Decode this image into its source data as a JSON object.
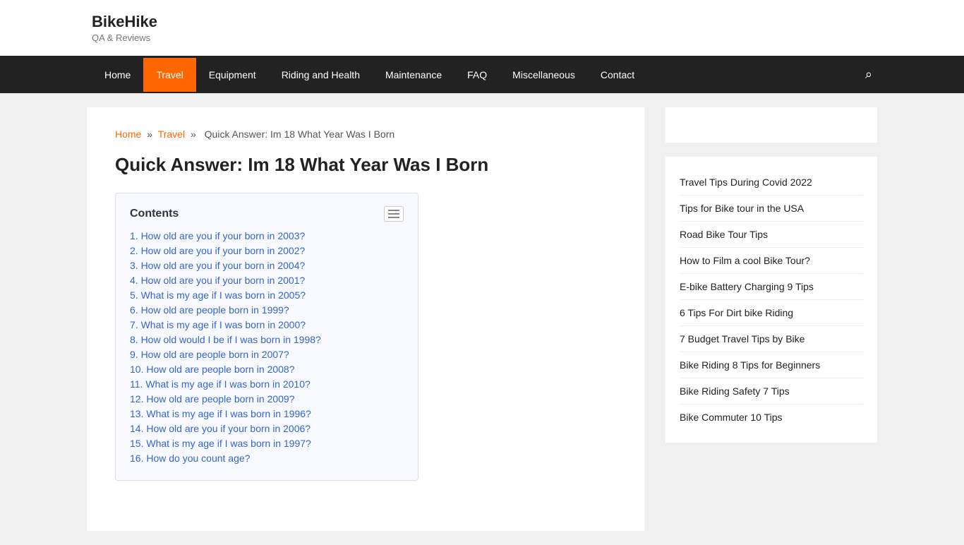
{
  "site": {
    "title": "BikeHike",
    "subtitle": "QA & Reviews"
  },
  "nav": {
    "items": [
      {
        "label": "Home",
        "active": false
      },
      {
        "label": "Travel",
        "active": true
      },
      {
        "label": "Equipment",
        "active": false
      },
      {
        "label": "Riding and Health",
        "active": false
      },
      {
        "label": "Maintenance",
        "active": false
      },
      {
        "label": "FAQ",
        "active": false
      },
      {
        "label": "Miscellaneous",
        "active": false
      },
      {
        "label": "Contact",
        "active": false
      }
    ]
  },
  "breadcrumb": {
    "home": "Home",
    "section": "Travel",
    "current": "Quick Answer: Im 18 What Year Was I Born",
    "sep1": "»",
    "sep2": "»"
  },
  "article": {
    "title": "Quick Answer: Im 18 What Year Was I Born",
    "toc_title": "Contents",
    "toc_items": [
      {
        "num": "1.",
        "text": "How old are you if your born in 2003?"
      },
      {
        "num": "2.",
        "text": "How old are you if your born in 2002?"
      },
      {
        "num": "3.",
        "text": "How old are you if your born in 2004?"
      },
      {
        "num": "4.",
        "text": "How old are you if your born in 2001?"
      },
      {
        "num": "5.",
        "text": "What is my age if I was born in 2005?"
      },
      {
        "num": "6.",
        "text": "How old are people born in 1999?"
      },
      {
        "num": "7.",
        "text": "What is my age if I was born in 2000?"
      },
      {
        "num": "8.",
        "text": "How old would I be if I was born in 1998?"
      },
      {
        "num": "9.",
        "text": "How old are people born in 2007?"
      },
      {
        "num": "10.",
        "text": "How old are people born in 2008?"
      },
      {
        "num": "11.",
        "text": "What is my age if I was born in 2010?"
      },
      {
        "num": "12.",
        "text": "How old are people born in 2009?"
      },
      {
        "num": "13.",
        "text": "What is my age if I was born in 1996?"
      },
      {
        "num": "14.",
        "text": "How old are you if your born in 2006?"
      },
      {
        "num": "15.",
        "text": "What is my age if I was born in 1997?"
      },
      {
        "num": "16.",
        "text": "How do you count age?"
      }
    ]
  },
  "sidebar": {
    "links": [
      "Travel Tips During Covid 2022",
      "Tips for Bike tour in the USA",
      "Road Bike Tour Tips",
      "How to Film a cool Bike Tour?",
      "E-bike Battery Charging 9 Tips",
      "6 Tips For Dirt bike Riding",
      "7 Budget Travel Tips by Bike",
      "Bike Riding 8 Tips for Beginners",
      "Bike Riding Safety 7 Tips",
      "Bike Commuter 10 Tips"
    ]
  }
}
